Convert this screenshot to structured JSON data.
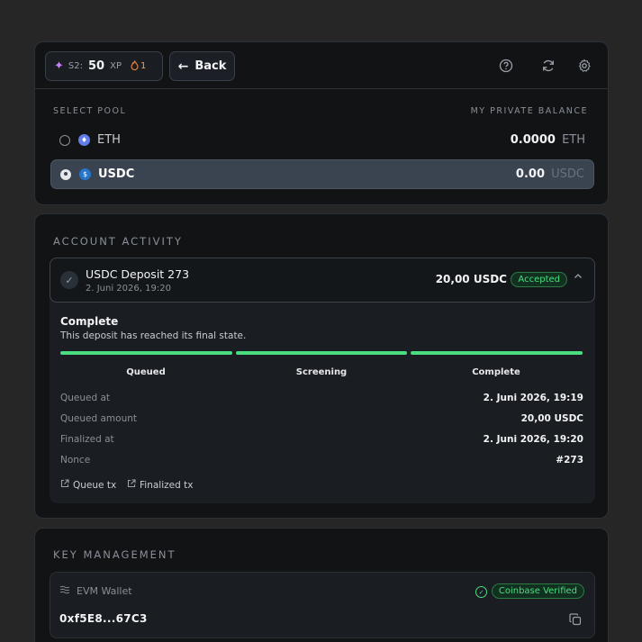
{
  "toolbar": {
    "season": "S2:",
    "xp_value": "50",
    "xp_unit": "XP",
    "streak": "1",
    "back_label": "Back"
  },
  "pool": {
    "select_label": "SELECT POOL",
    "balance_label": "MY PRIVATE BALANCE",
    "items": [
      {
        "name": "ETH",
        "balance": "0.0000",
        "currency": "ETH",
        "selected": false
      },
      {
        "name": "USDC",
        "balance": "0.00",
        "currency": "USDC",
        "selected": true
      }
    ]
  },
  "activity": {
    "title": "ACCOUNT ACTIVITY",
    "item": {
      "title": "USDC Deposit 273",
      "date": "2. Juni 2026, 19:20",
      "amount": "20,00 USDC",
      "status_badge": "Accepted",
      "status_title": "Complete",
      "status_description": "This deposit has reached its final state.",
      "progress_fraction": 1.0,
      "steps": [
        "Queued",
        "Screening",
        "Complete"
      ],
      "details": [
        {
          "label": "Queued at",
          "value": "2. Juni 2026, 19:19"
        },
        {
          "label": "Queued amount",
          "value": "20,00 USDC"
        },
        {
          "label": "Finalized at",
          "value": "2. Juni 2026, 19:20"
        },
        {
          "label": "Nonce",
          "value": "#273"
        }
      ],
      "links": [
        "Queue tx",
        "Finalized tx"
      ]
    }
  },
  "keys": {
    "title": "KEY MANAGEMENT",
    "wallet": {
      "label": "EVM Wallet",
      "badge": "Coinbase Verified",
      "address": "0xf5E8...67C3"
    }
  },
  "colors": {
    "accent_green": "#4ade80",
    "eth": "#627eea",
    "usdc": "#2775ca",
    "xp_sparkle": "#c77dff",
    "streak_flame": "#f0883e"
  }
}
